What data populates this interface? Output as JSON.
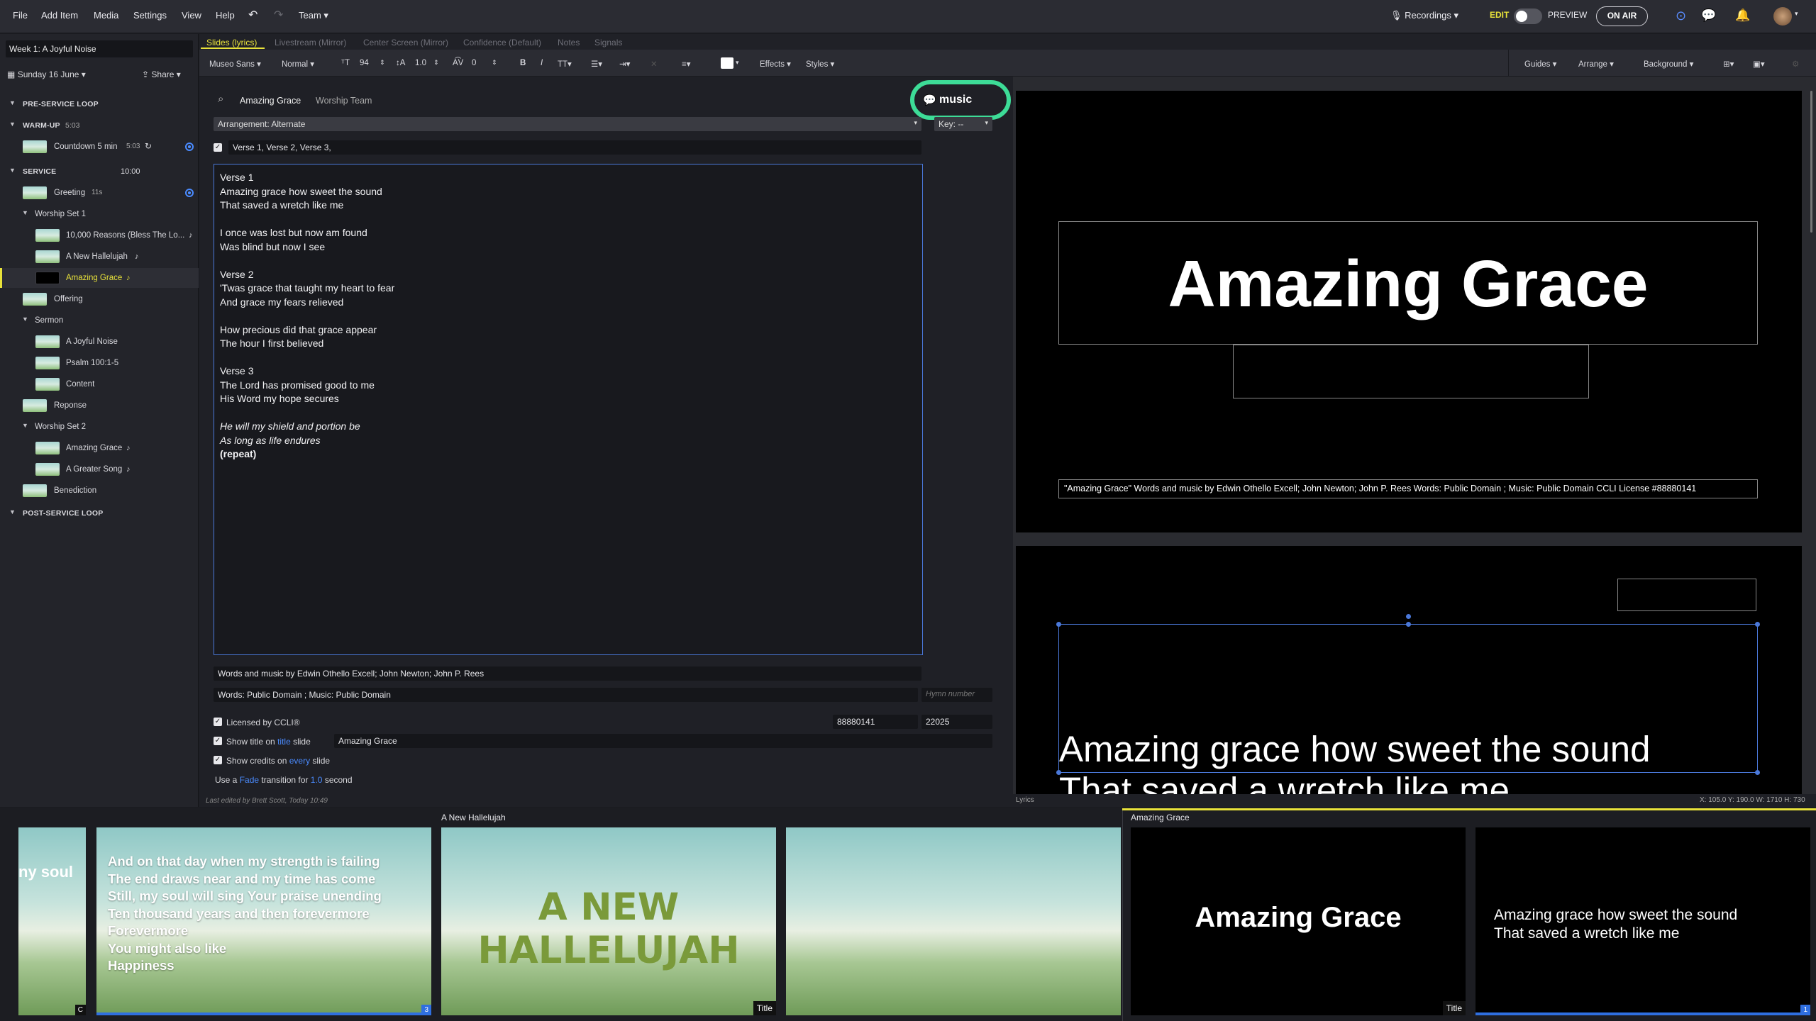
{
  "topbar": {
    "menu": [
      "File",
      "Add Item",
      "Media",
      "Settings",
      "View",
      "Help"
    ],
    "team": "Team",
    "recordings": "Recordings",
    "edit": "EDIT",
    "preview": "PREVIEW",
    "on_air": "ON AIR"
  },
  "sidebar": {
    "plan_title": "Week 1: A Joyful Noise",
    "date": "Sunday 16 June",
    "share": "Share",
    "pre_service": "PRE-SERVICE LOOP",
    "warmup": "WARM-UP",
    "warmup_time": "5:03",
    "countdown": "Countdown 5 min",
    "countdown_time": "5:03",
    "service": "SERVICE",
    "service_time": "10:00",
    "greeting": "Greeting",
    "greeting_time": "11s",
    "worship_set1": "Worship Set 1",
    "item_10000": "10,000 Reasons (Bless The Lo...",
    "item_hallelujah": "A New Hallelujah",
    "item_amazing": "Amazing Grace",
    "offering": "Offering",
    "sermon": "Sermon",
    "sermon_joyful": "A Joyful Noise",
    "sermon_psalm": "Psalm 100:1-5",
    "sermon_content": "Content",
    "reponse": "Reponse",
    "worship_set2": "Worship Set 2",
    "ws2_amazing": "Amazing Grace",
    "ws2_greater": "A Greater Song",
    "benediction": "Benediction",
    "post_service": "POST-SERVICE LOOP"
  },
  "tabs": [
    "Slides (lyrics)",
    "Livestream (Mirror)",
    "Center Screen (Mirror)",
    "Confidence (Default)",
    "Notes",
    "Signals"
  ],
  "format": {
    "font": "Museo Sans",
    "weight": "Normal",
    "size": "94",
    "line": "1.0",
    "spacing": "0",
    "effects": "Effects",
    "styles": "Styles",
    "guides": "Guides",
    "arrange": "Arrange",
    "background": "Background"
  },
  "song": {
    "title": "Amazing Grace",
    "author_tag": "Worship Team",
    "music_badge": "music",
    "arrangement": "Arrangement: Alternate",
    "key": "Key: --",
    "sequence": "Verse 1, Verse 2, Verse 3,",
    "lyrics": [
      "Verse 1",
      "Amazing grace how sweet the sound",
      "That saved a wretch like me",
      "",
      "I once was lost but now am found",
      "Was blind but now I see",
      "",
      "Verse 2",
      "'Twas grace that taught my heart to fear",
      "And grace my fears relieved",
      "",
      "How precious did that grace appear",
      "The hour I first believed",
      "",
      "Verse 3",
      "The Lord has promised good to me",
      "His Word my hope secures",
      "",
      "He will my shield and portion be",
      "As long as life endures",
      "(repeat)"
    ],
    "credits1": "Words and music by Edwin Othello Excell; John Newton; John P. Rees",
    "credits2": "Words: Public Domain ; Music: Public Domain",
    "hymn_placeholder": "Hymn number",
    "ccli_label": "Licensed by CCLI®",
    "ccli_number": "88880141",
    "ccli_song": "22025",
    "show_title_a": "Show title on",
    "show_title_b": "title",
    "show_title_c": "slide",
    "show_title_value": "Amazing Grace",
    "show_credits_a": "Show credits on",
    "show_credits_b": "every",
    "show_credits_c": "slide",
    "trans_a": "Use a",
    "trans_b": "Fade",
    "trans_c": "transition for",
    "trans_d": "1.0",
    "trans_e": "second",
    "last_edited": "Last edited by Brett Scott, Today 10:49"
  },
  "preview": {
    "title": "Amazing Grace",
    "credits": "\"Amazing Grace\" Words and music by Edwin Othello Excell; John Newton; John P. Rees Words: Public Domain ; Music: Public Domain CCLI License #88880141",
    "line1": "Amazing grace how sweet the sound",
    "line2": "That saved a wretch like me",
    "label": "Lyrics",
    "coords": "X: 105.0  Y: 190.0   W: 1710  H: 730"
  },
  "filmstrip": {
    "group1": "A New Hallelujah",
    "group2": "Amazing Grace",
    "partial": "ny soul",
    "partial_badge": "C",
    "slide1": [
      "And on that day when my strength is failing",
      "The end draws near and my time has come",
      "Still, my soul will sing Your praise unending",
      "Ten thousand years and then forevermore",
      "Forevermore",
      "You might also like",
      "Happiness"
    ],
    "slide1_badge": "3",
    "slide2_title": "A NEW HALLELUJAH",
    "slide2_badge": "Title",
    "slide4_title": "Amazing Grace",
    "slide4_badge": "Title",
    "slide5_l1": "Amazing grace how sweet the sound",
    "slide5_l2": "That saved a wretch like me",
    "slide5_badge": "1"
  }
}
